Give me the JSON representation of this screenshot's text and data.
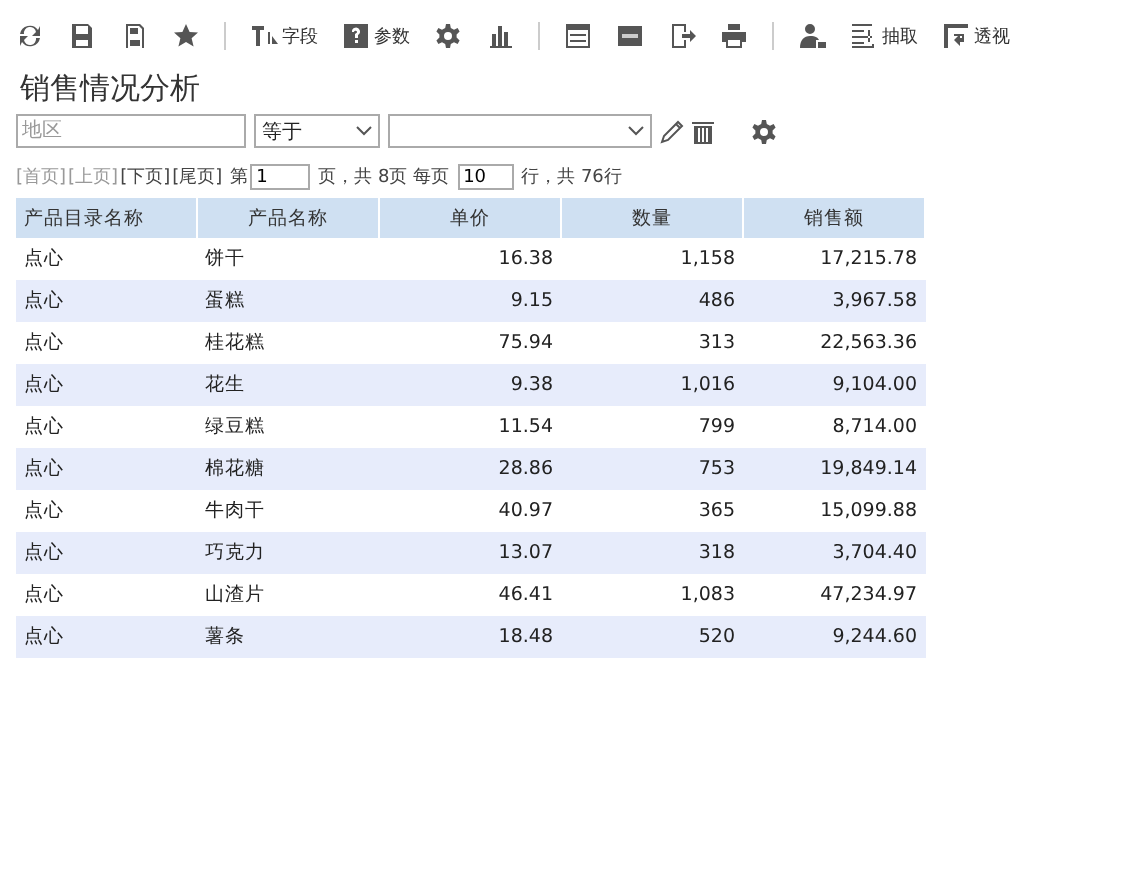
{
  "toolbar": [
    {
      "label": "字段"
    },
    {
      "label": "参数"
    },
    {
      "label": "抽取"
    },
    {
      "label": "透视"
    }
  ],
  "title": "销售情况分析",
  "filter": {
    "field": {
      "placeholder": "地区"
    },
    "operator": {
      "value": "等于"
    }
  },
  "pager": {
    "links": [
      {
        "label": "[首页]",
        "disabled": true
      },
      {
        "label": "[上页]",
        "disabled": true
      },
      {
        "label": "[下页]",
        "disabled": false
      },
      {
        "label": "[尾页]",
        "disabled": false
      }
    ],
    "page_prefix": "第",
    "page": "1",
    "page_suffix": "页，共 8页 每页",
    "per_page": "10",
    "total": "行，共 76行"
  },
  "table": {
    "columns": [
      "产品目录名称",
      "产品名称",
      "单价",
      "数量",
      "销售额"
    ],
    "rows": [
      [
        "点心",
        "饼干",
        "16.38",
        "1,158",
        "17,215.78"
      ],
      [
        "点心",
        "蛋糕",
        "9.15",
        "486",
        "3,967.58"
      ],
      [
        "点心",
        "桂花糕",
        "75.94",
        "313",
        "22,563.36"
      ],
      [
        "点心",
        "花生",
        "9.38",
        "1,016",
        "9,104.00"
      ],
      [
        "点心",
        "绿豆糕",
        "11.54",
        "799",
        "8,714.00"
      ],
      [
        "点心",
        "棉花糖",
        "28.86",
        "753",
        "19,849.14"
      ],
      [
        "点心",
        "牛肉干",
        "40.97",
        "365",
        "15,099.88"
      ],
      [
        "点心",
        "巧克力",
        "13.07",
        "318",
        "3,704.40"
      ],
      [
        "点心",
        "山渣片",
        "46.41",
        "1,083",
        "47,234.97"
      ],
      [
        "点心",
        "薯条",
        "18.48",
        "520",
        "9,244.60"
      ]
    ]
  }
}
